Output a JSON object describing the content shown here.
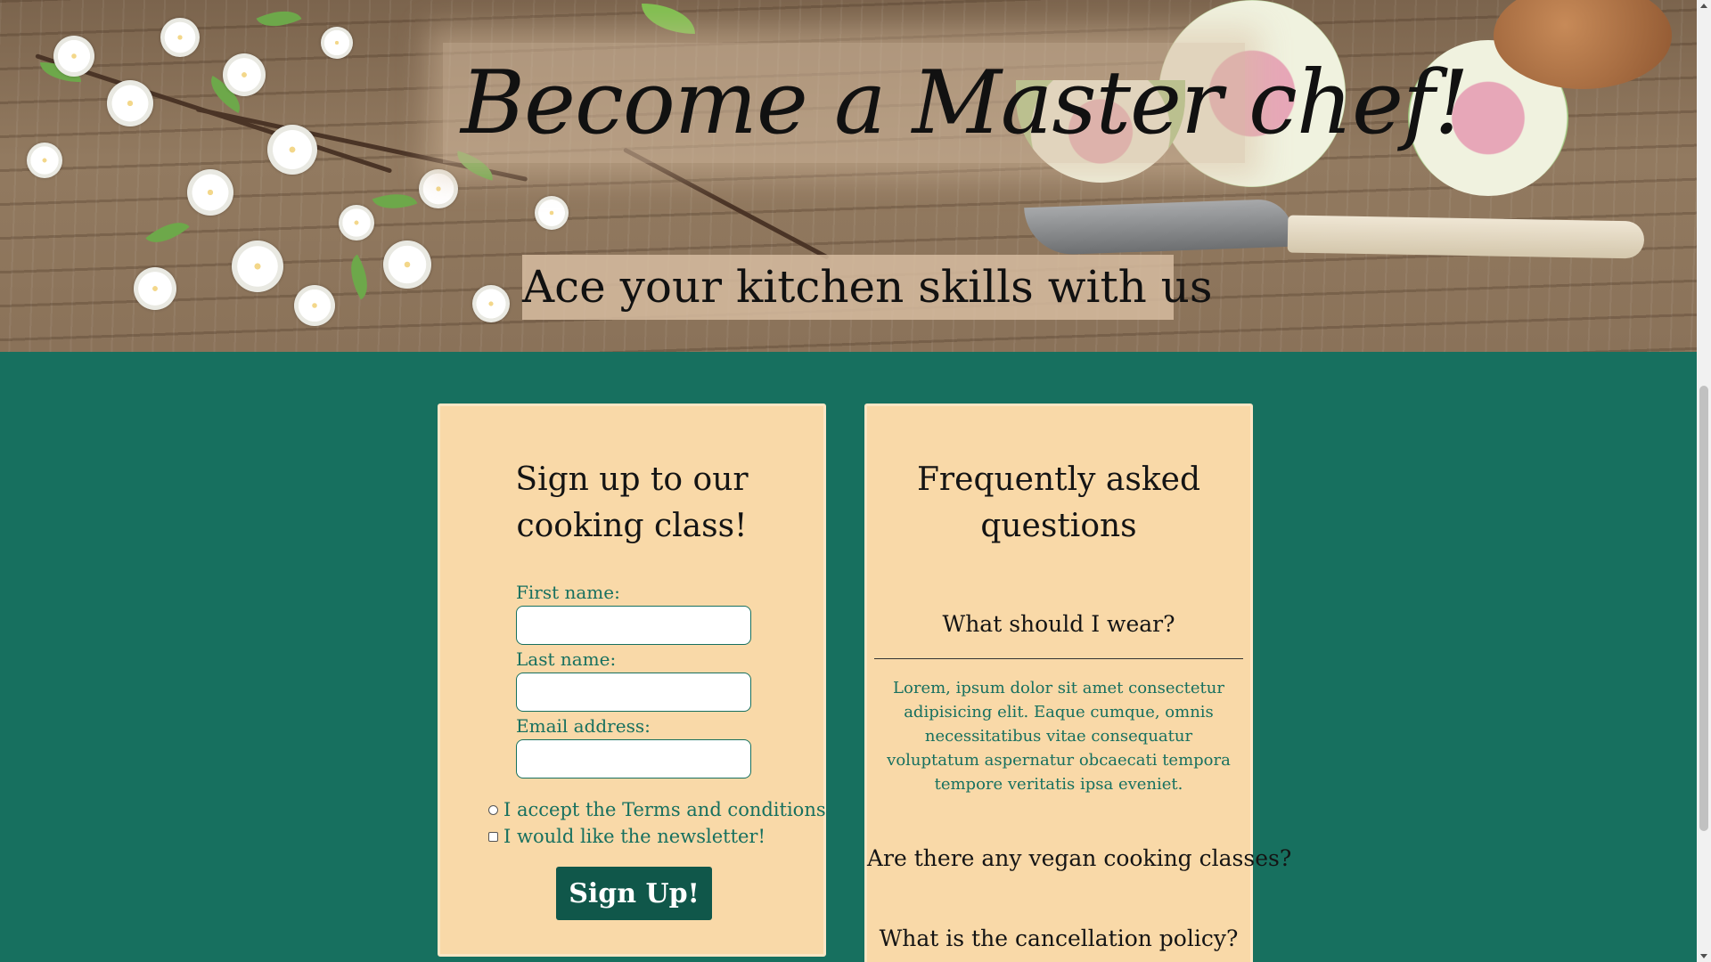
{
  "hero": {
    "title": "Become a Master chef!",
    "subtitle": "Ace your kitchen skills with us"
  },
  "signup": {
    "title": "Sign up to our cooking class!",
    "first_name_label": "First name:",
    "first_name_value": "",
    "last_name_label": "Last name:",
    "last_name_value": "",
    "email_label": "Email address:",
    "email_value": "",
    "terms_label": "I accept the Terms and conditions",
    "terms_checked": false,
    "newsletter_label": "I would like the newsletter!",
    "newsletter_checked": false,
    "button_label": "Sign Up!"
  },
  "faq": {
    "title": "Frequently asked questions",
    "items": [
      {
        "question": "What should I wear?",
        "answer": "Lorem, ipsum dolor sit amet consectetur adipisicing elit. Eaque cumque, omnis necessitatibus vitae consequatur voluptatum aspernatur obcaecati tempora tempore veritatis ipsa eveniet.",
        "expanded": true
      },
      {
        "question": "Are there any vegan cooking classes?",
        "expanded": false
      },
      {
        "question": "What is the cancellation policy?",
        "expanded": false
      }
    ]
  },
  "colors": {
    "background": "#17705f",
    "card": "#f9d9a8",
    "button": "#10574a",
    "accent_text": "#17705f"
  },
  "icons": {
    "scroll_up": "chevron-up-icon",
    "scroll_down": "chevron-down-icon"
  }
}
